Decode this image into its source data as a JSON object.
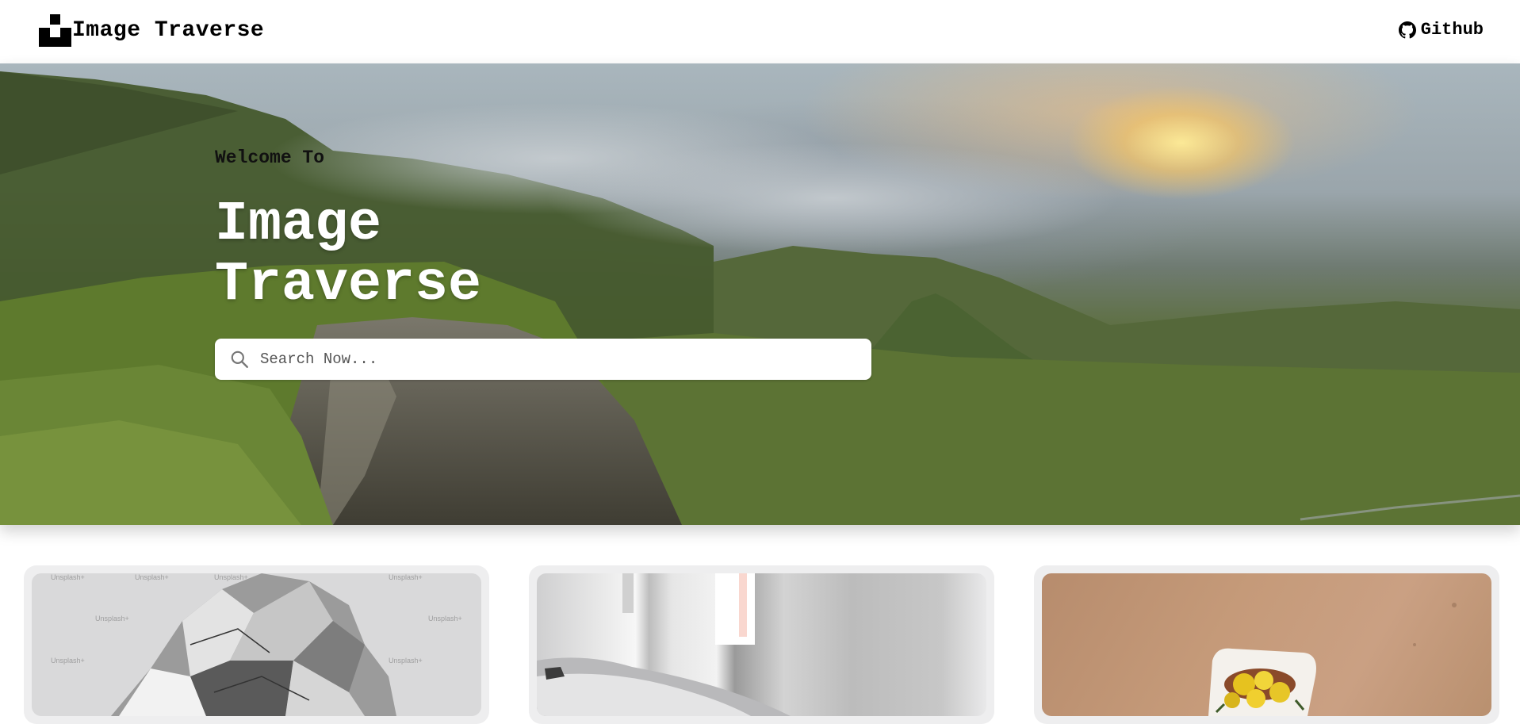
{
  "brand": {
    "name": "Image Traverse",
    "logo_icon": "unsplash-logo-icon"
  },
  "nav": {
    "github_label": "Github",
    "github_icon": "github-icon"
  },
  "hero": {
    "welcome": "Welcome To",
    "title_line1": "Image",
    "title_line2": "Traverse",
    "search": {
      "placeholder": "Search Now...",
      "value": "",
      "icon": "search-icon"
    }
  },
  "cards": [
    {
      "description": "crumpled silver foil sculpture on grey background",
      "watermark": "Unsplash+"
    },
    {
      "description": "silver car in grey interior"
    },
    {
      "description": "yellow flowers in white vase on beige wall"
    }
  ],
  "colors": {
    "navbar_bg": "#ffffff",
    "card_bg": "#eeeeef",
    "title_text": "#ffffff"
  }
}
